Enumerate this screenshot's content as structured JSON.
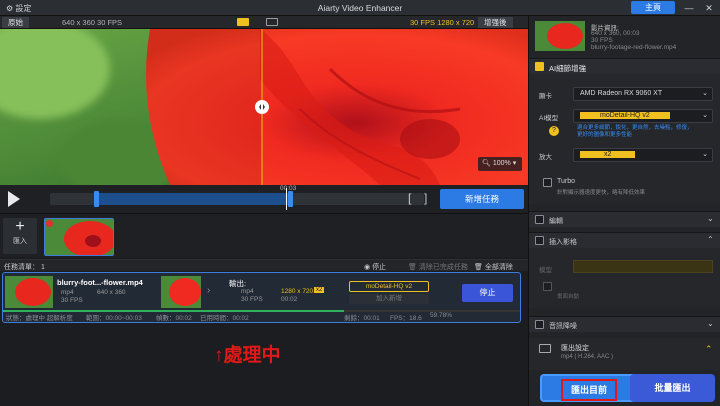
{
  "titlebar": {
    "settings": "設定",
    "title": "Aiarty Video Enhancer",
    "main_button": "主頁",
    "minimize": "—",
    "maximize": "☐",
    "close": "✕"
  },
  "preview": {
    "original_label": "原始",
    "original_info": "640 x 360  30 FPS",
    "enhanced_info": "30 FPS  1280 x 720",
    "after_label": "增强後",
    "zoom": "100%",
    "time": "00:03"
  },
  "controls": {
    "new_task": "新增任務",
    "bracket_left": "[",
    "bracket_right": "]"
  },
  "import": {
    "label": "匯入",
    "plus": "+"
  },
  "queue": {
    "label": "任務清單：",
    "count": "1",
    "stop": "停止",
    "clear_done": "清除已完成任務",
    "clear_all": "全部清除"
  },
  "task": {
    "filename": "blurry-foot...-flower.mp4",
    "in_format": "mp4",
    "in_res": "640 x 360",
    "in_fps": "30 FPS",
    "output_label": "輸出:",
    "out_format": "mp4",
    "out_res": "1280 x 720",
    "out_scale": "x2",
    "out_fps": "30 FPS",
    "out_time": "00:02",
    "model": "moDetail-HQ  v2",
    "add_preset": "加入新增",
    "stop_button": "停止",
    "progress_pct": 0.66
  },
  "status_bar": {
    "state": "狀態：處理中 超解析度",
    "range": "範圍：00:00~00:03",
    "frames": "幀數：00:02",
    "elapsed": "已用時間：00:02",
    "remain": "剩餘：00:01",
    "fps": "FPS：18.6",
    "percent": "59.78%"
  },
  "annotation": {
    "text": "↑處理中"
  },
  "sidebar": {
    "info_title": "影片資訊:",
    "info_res": "640 x 360, 00:03",
    "info_fps": "30 FPS",
    "info_file": "blurry-footage-red-flower.mp4",
    "ai_title": "AI細節增強",
    "gpu_label": "顯卡",
    "gpu_value": "AMD Radeon RX 9060 XT",
    "model_label": "AI模型",
    "model_value": "moDetail-HQ  v2",
    "model_desc": "適合更多細節，銳化，更自然，去噪點，修復，更好的圖像和更多性能",
    "scale_label": "放大",
    "scale_value": "x2",
    "turbo_label": "Turbo",
    "turbo_desc": "針對顯示器速度更快，略有降低效果",
    "edit_label": "編輯",
    "interp_label": "插入影格",
    "interp_model": "模型",
    "interp_desc": "畫面自動",
    "noise_label": "音訊降噪",
    "export_label": "匯出設定",
    "export_desc": "mp4 ( H.264, AAC )",
    "export_btn": "匯出目前",
    "batch_btn": "批量匯出"
  },
  "colors": {
    "accent": "#2c7be5",
    "highlight": "#f0c020",
    "annotation": "#e01818"
  }
}
